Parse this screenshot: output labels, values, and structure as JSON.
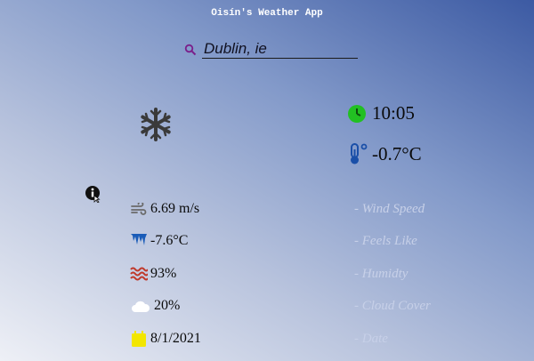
{
  "app": {
    "title": "Oisín's Weather App"
  },
  "search": {
    "value": "Dublin, ie"
  },
  "current": {
    "condition_icon": "snowflake-icon",
    "time": "10:05",
    "temperature": "-0.7°C"
  },
  "details": [
    {
      "icon": "wind-icon",
      "value": "6.69 m/s",
      "label": "- Wind Speed"
    },
    {
      "icon": "icicles-icon",
      "value": "-7.6°C",
      "label": "- Feels Like"
    },
    {
      "icon": "humidity-waves-icon",
      "value": "93%",
      "label": "- Humidty"
    },
    {
      "icon": "cloud-icon",
      "value": "20%",
      "label": "- Cloud Cover"
    },
    {
      "icon": "calendar-icon",
      "value": "8/1/2021",
      "label": "- Date"
    }
  ],
  "colors": {
    "clock": "#22c022",
    "thermometer": "#1a4fa8",
    "search_icon": "#7a1f8a",
    "calendar": "#f2e600",
    "humidity": "#c0392b"
  }
}
